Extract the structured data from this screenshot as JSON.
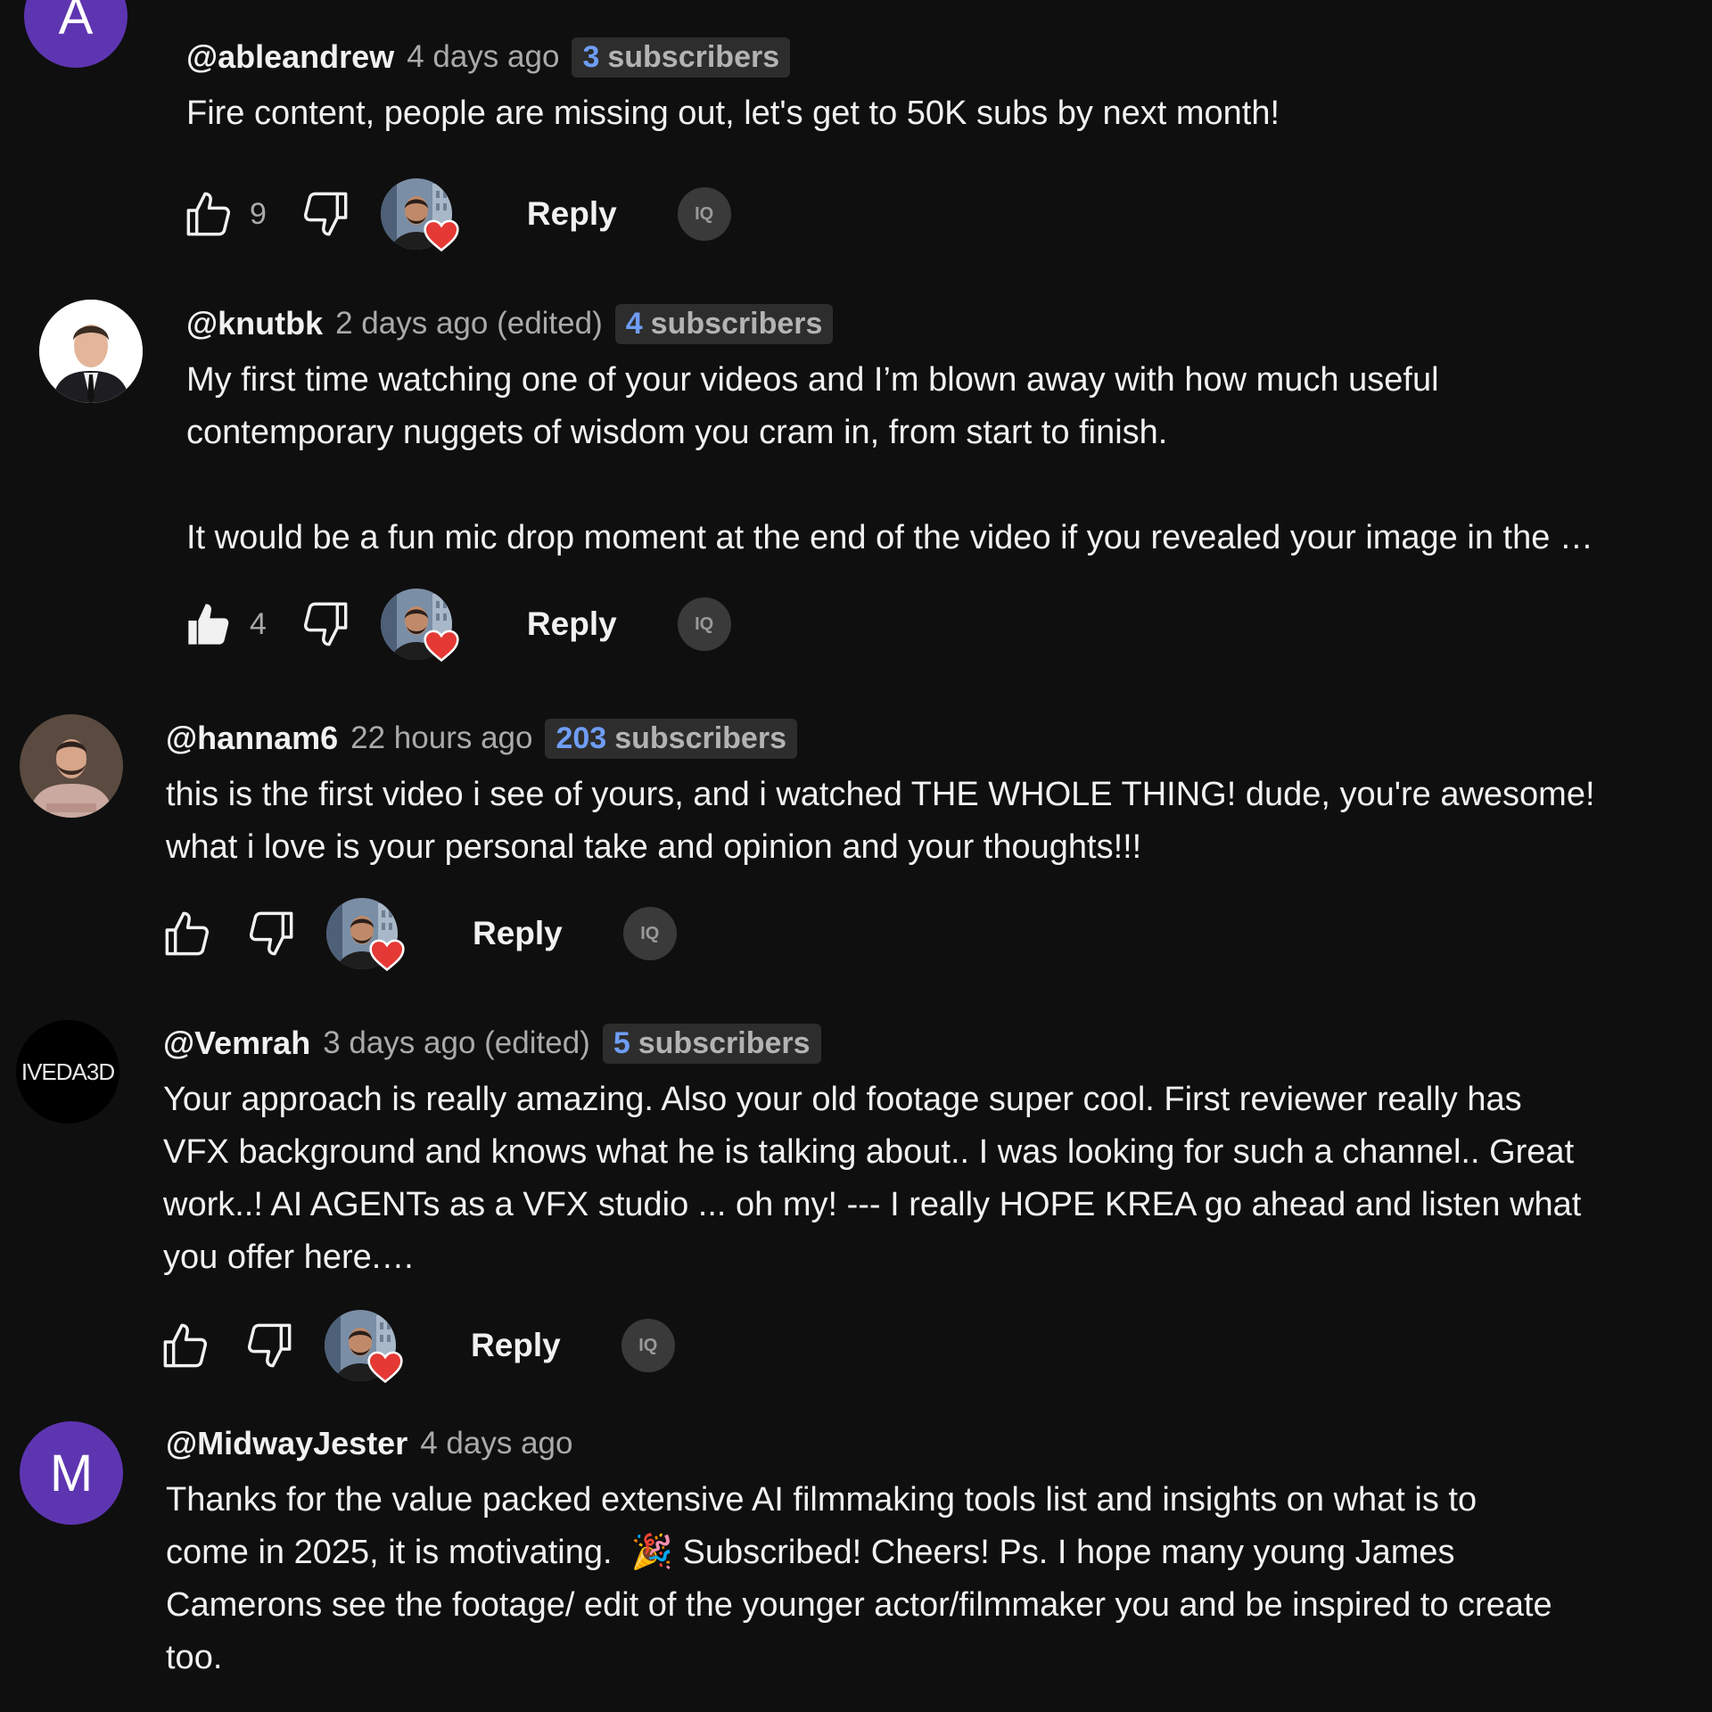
{
  "colors": {
    "background": "#0f0f0f",
    "badge_number": "#6f9df5",
    "heart": "#e53935",
    "letter_avatar": "#5e35b1"
  },
  "icons": {
    "like": "thumb-up-outline-icon",
    "liked": "thumb-up-filled-icon",
    "dislike": "thumb-down-outline-icon",
    "creator_heart": "heart-icon",
    "extension": "extension-icon"
  },
  "comments": [
    {
      "avatar_letter": "A",
      "author": "@ableandrew",
      "time": "4 days ago",
      "badge_number": "3",
      "badge_text": "subscribers",
      "text": "Fire content, people are missing out, let's get to 50K subs by next month!",
      "likes": "9",
      "reply_label": "Reply",
      "ext_label": "IQ"
    },
    {
      "author": "@knutbk",
      "time": "2 days ago (edited)",
      "badge_number": "4",
      "badge_text": "subscribers",
      "text": "My first time watching one of your videos and I’m blown away with how much useful\ncontemporary nuggets of wisdom you cram in, from start to finish.\n\nIt would be a fun mic drop moment at the end of the video if you revealed your image in the …",
      "likes": "4",
      "reply_label": "Reply",
      "ext_label": "IQ"
    },
    {
      "author": "@hannam6",
      "time": "22 hours ago",
      "badge_number": "203",
      "badge_text": "subscribers",
      "text": "this is the first video i see of yours, and i watched THE WHOLE THING! dude, you're awesome!\nwhat i love is your personal take and opinion and your thoughts!!!",
      "reply_label": "Reply",
      "ext_label": "IQ"
    },
    {
      "avatar_text": "IVEDA3D",
      "author": "@Vemrah",
      "time": "3 days ago (edited)",
      "badge_number": "5",
      "badge_text": "subscribers",
      "text": "Your approach is really amazing. Also your old footage super cool. First reviewer really has\nVFX background and knows what he is talking about.. I was looking for such a channel.. Great\nwork..! AI AGENTs as a VFX studio ... oh my! --- I really HOPE KREA go ahead and listen what\nyou offer here.…",
      "reply_label": "Reply",
      "ext_label": "IQ"
    },
    {
      "avatar_letter": "M",
      "author": "@MidwayJester",
      "time": "4 days ago",
      "text": "Thanks for the value packed extensive AI filmmaking tools list and insights on what is to\ncome in 2025, it is motivating.  🎉 Subscribed! Cheers! Ps. I hope many young James\nCamerons see the footage/ edit of the younger actor/filmmaker you and be inspired to create\ntoo."
    }
  ]
}
